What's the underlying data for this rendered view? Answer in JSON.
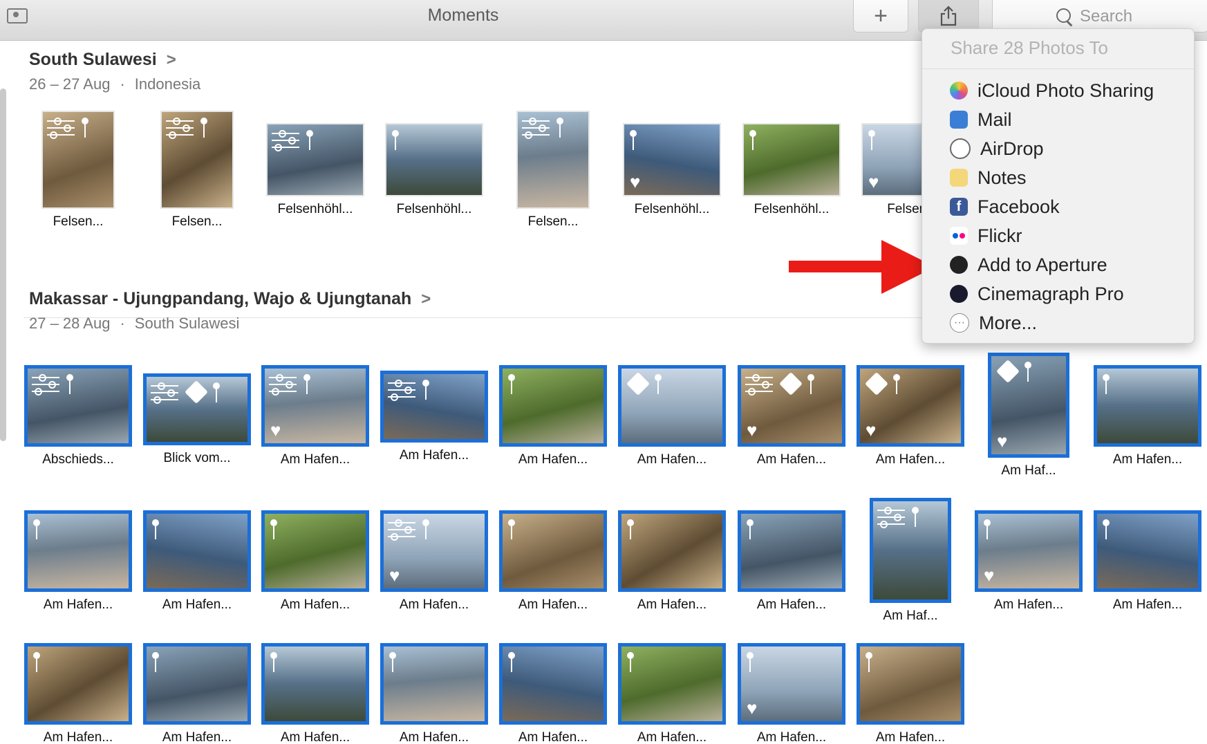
{
  "toolbar": {
    "title": "Moments",
    "add_label": "+",
    "search_placeholder": "Search",
    "icons": [
      "sidebar-toggle-icon",
      "add-icon",
      "share-icon",
      "search-icon"
    ]
  },
  "sections": [
    {
      "title": "South Sulawesi",
      "date": "26 – 27 Aug",
      "place": "Indonesia"
    },
    {
      "title": "Makassar - Ujungpandang, Wajo & Ujungtanah",
      "date": "27 – 28 Aug",
      "place": "South Sulawesi"
    }
  ],
  "photos_row1": [
    "Felsen...",
    "Felsen...",
    "Felsenhöhl...",
    "Felsenhöhl...",
    "Felsen...",
    "Felsenhöhl...",
    "Felsenhöhl...",
    "Felsenh"
  ],
  "photos_row2": [
    "Abschieds...",
    "Blick vom...",
    "Am Hafen...",
    "Am Hafen...",
    "Am Hafen...",
    "Am Hafen...",
    "Am Hafen...",
    "Am Hafen...",
    "Am Haf...",
    "Am Hafen..."
  ],
  "photos_row3": [
    "Am Hafen...",
    "Am Hafen...",
    "Am Hafen...",
    "Am Hafen...",
    "Am Hafen...",
    "Am Hafen...",
    "Am Hafen...",
    "Am Haf...",
    "Am Hafen...",
    "Am Hafen..."
  ],
  "photos_row4": [
    "Am Hafen...",
    "Am Hafen...",
    "Am Hafen...",
    "Am Hafen...",
    "Am Hafen...",
    "Am Hafen...",
    "Am Hafen...",
    "Am Hafen..."
  ],
  "share_menu": {
    "header": "Share 28 Photos To",
    "items": [
      {
        "label": "iCloud Photo Sharing",
        "icon": "icloud-photos-icon",
        "color": "#f2a33a"
      },
      {
        "label": "Mail",
        "icon": "mail-icon",
        "color": "#3a7fd5"
      },
      {
        "label": "AirDrop",
        "icon": "airdrop-icon",
        "color": "#6a6a6a"
      },
      {
        "label": "Notes",
        "icon": "notes-icon",
        "color": "#f4d77a"
      },
      {
        "label": "Facebook",
        "icon": "facebook-icon",
        "color": "#3b5998"
      },
      {
        "label": "Flickr",
        "icon": "flickr-icon",
        "color": "#ff0084"
      },
      {
        "label": "Add to Aperture",
        "icon": "aperture-icon",
        "color": "#222222"
      },
      {
        "label": "Cinemagraph Pro",
        "icon": "cinemagraph-icon",
        "color": "#1a1a2e"
      },
      {
        "label": "More...",
        "icon": "more-icon",
        "color": "#8a8a8a"
      }
    ]
  },
  "colors": {
    "selection": "#1b6fd8",
    "arrow": "#ea1c17"
  }
}
